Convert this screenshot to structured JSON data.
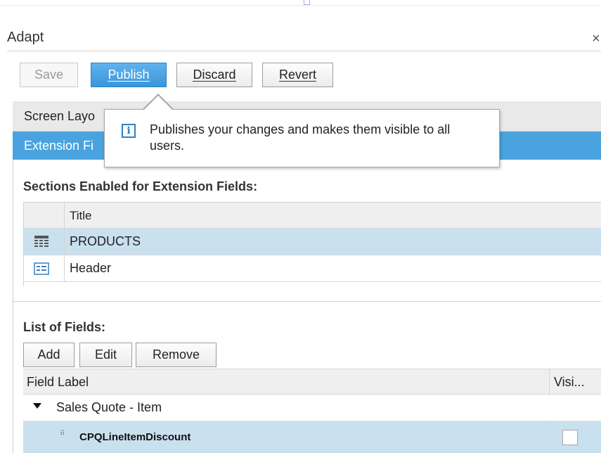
{
  "dialog": {
    "title": "Adapt",
    "close_glyph": "×"
  },
  "toolbar": {
    "save_label": "Save",
    "publish_label": "Publish",
    "discard_label": "Discard",
    "revert_label": "Revert"
  },
  "navigation": {
    "screen_layout_label": "Screen Layo",
    "extension_fields_label": "Extension Fi"
  },
  "tooltip": {
    "icon": "info-icon",
    "text": "Publishes your changes and makes them visible to all users."
  },
  "sections": {
    "heading": "Sections Enabled for Extension Fields:",
    "column_title": "Title",
    "rows": [
      {
        "icon": "table-icon",
        "title": "PRODUCTS",
        "selected": true
      },
      {
        "icon": "form-icon",
        "title": "Header",
        "selected": false
      }
    ]
  },
  "fields": {
    "heading": "List of Fields:",
    "add_label": "Add",
    "edit_label": "Edit",
    "remove_label": "Remove",
    "column_field_label": "Field Label",
    "column_visible": "Visi...",
    "group": "Sales Quote - Item",
    "rows": [
      {
        "label": "CPQLineItemDiscount",
        "visible": false
      }
    ]
  },
  "colors": {
    "accent": "#4aa3df",
    "selected_row": "#c9e0ef",
    "primary_button": "#3897dc"
  }
}
